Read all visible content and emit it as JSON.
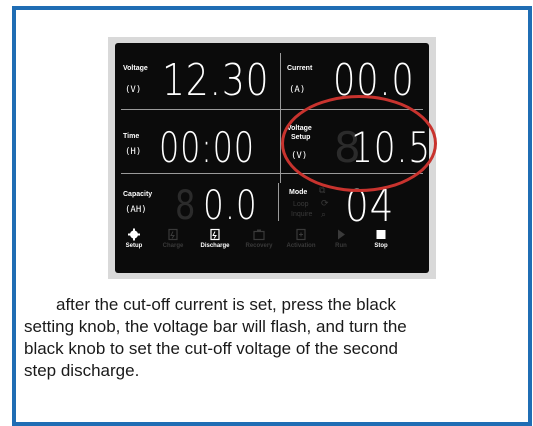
{
  "display": {
    "voltage": {
      "label": "Voltage",
      "unit": "(V)",
      "value": "12.30"
    },
    "current": {
      "label": "Current",
      "unit": "(A)",
      "value": "00.0"
    },
    "time": {
      "label": "Time",
      "unit": "(H)",
      "value": "00:00"
    },
    "voltage_setup": {
      "label1": "Voltage",
      "label2": "Setup",
      "unit": "(V)",
      "value": "10.5"
    },
    "capacity": {
      "label": "Capacity",
      "unit": "(AH)",
      "value": "0.0"
    },
    "mode": {
      "label": "Mode",
      "sub1": "Loop",
      "sub2": "Inquire",
      "value": "04"
    },
    "footer": [
      {
        "label": "Setup",
        "active": true,
        "icon": "gear-icon"
      },
      {
        "label": "Charge",
        "active": false,
        "icon": "charge-icon"
      },
      {
        "label": "Discharge",
        "active": true,
        "icon": "discharge-icon"
      },
      {
        "label": "Recovery",
        "active": false,
        "icon": "recovery-icon"
      },
      {
        "label": "Activation",
        "active": false,
        "icon": "activation-icon"
      },
      {
        "label": "Run",
        "active": false,
        "icon": "play-icon"
      },
      {
        "label": "Stop",
        "active": true,
        "icon": "stop-icon"
      }
    ]
  },
  "highlight_color": "#c8332e",
  "frame_color": "#1f6db4",
  "caption": {
    "line1": "after the cut-off current is set, press the black",
    "line2": "setting knob, the voltage bar will flash, and turn the",
    "line3": "black knob to set the cut-off voltage of the second",
    "line4": "step discharge."
  }
}
